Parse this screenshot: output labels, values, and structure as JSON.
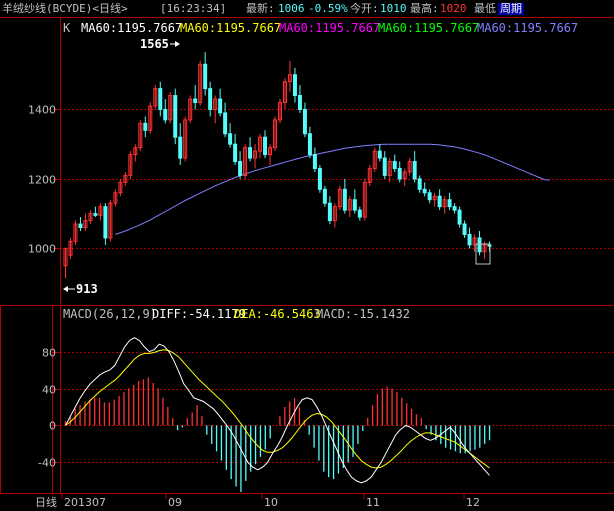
{
  "header": {
    "instrument": "羊绒纱线(BCYDE)<日线>",
    "time": "[16:23:34]",
    "latest_label": "最新:",
    "latest_value": "1006",
    "change_pct": "-0.59%",
    "open_label": "今开:",
    "open_value": "1010",
    "high_label": "最高:",
    "high_value": "1020",
    "last_label": "最低",
    "period_label": "周期"
  },
  "price_panel": {
    "k_label": "K",
    "ma_labels": [
      "MA60:1195.7667",
      "MA60:1195.7667",
      "MA60:1195.7667",
      "MA60:1195.7667",
      "MA60:1195.7667"
    ],
    "ma_colors": [
      "#ffffff",
      "#ffff00",
      "#ff00ff",
      "#00ff00",
      "#8080ff"
    ],
    "y_ticks": [
      "1400",
      "1200",
      "1000"
    ],
    "annotations": {
      "high": "1565",
      "low": "913"
    }
  },
  "macd_panel": {
    "title": "MACD(26,12,9)",
    "diff": "DIFF:-54.1179",
    "dea": "DEA:-46.5463",
    "macd": "MACD:-15.1432",
    "y_ticks": [
      "80",
      "40",
      "0",
      "-40"
    ]
  },
  "x_axis": {
    "period": "日线",
    "labels": [
      "201307",
      "09",
      "10",
      "11",
      "12"
    ]
  },
  "colors": {
    "up": "#ff3232",
    "down": "#54fcfc",
    "grid": "#b00000",
    "ma_line": "#8080ff",
    "diff": "#ffffff",
    "dea": "#ffff00",
    "bg": "#000000"
  },
  "chart_data": {
    "type": "candlestick",
    "price_ylim": [
      880,
      1600
    ],
    "macd_ylim": [
      -72,
      112
    ],
    "high": 1565,
    "low": 913,
    "ma60": [
      null,
      null,
      null,
      null,
      null,
      null,
      null,
      null,
      null,
      null,
      1040,
      1045,
      1050,
      1056,
      1062,
      1068,
      1075,
      1082,
      1090,
      1098,
      1106,
      1114,
      1122,
      1130,
      1138,
      1145,
      1152,
      1159,
      1166,
      1173,
      1180,
      1186,
      1192,
      1198,
      1204,
      1209,
      1214,
      1219,
      1224,
      1228,
      1232,
      1236,
      1240,
      1244,
      1248,
      1252,
      1256,
      1260,
      1264,
      1267,
      1270,
      1273,
      1276,
      1279,
      1282,
      1285,
      1288,
      1290,
      1292,
      1294,
      1296,
      1297,
      1298,
      1299,
      1300,
      1300,
      1300,
      1300,
      1300,
      1300,
      1300,
      1300,
      1300,
      1300,
      1299,
      1298,
      1296,
      1294,
      1292,
      1289,
      1286,
      1282,
      1278,
      1274,
      1269,
      1264,
      1258,
      1252,
      1246,
      1240,
      1234,
      1228,
      1222,
      1216,
      1210,
      1204,
      1198,
      1196
    ],
    "candles": [
      [
        950,
        1000,
        913,
        1000
      ],
      [
        980,
        1030,
        970,
        1020
      ],
      [
        1020,
        1080,
        1010,
        1070
      ],
      [
        1070,
        1090,
        1050,
        1060
      ],
      [
        1060,
        1100,
        1050,
        1080
      ],
      [
        1080,
        1110,
        1070,
        1100
      ],
      [
        1100,
        1120,
        1090,
        1095
      ],
      [
        1095,
        1130,
        1080,
        1120
      ],
      [
        1120,
        1130,
        1010,
        1030
      ],
      [
        1030,
        1140,
        1020,
        1130
      ],
      [
        1130,
        1170,
        1120,
        1160
      ],
      [
        1160,
        1200,
        1150,
        1190
      ],
      [
        1190,
        1220,
        1180,
        1210
      ],
      [
        1210,
        1280,
        1200,
        1270
      ],
      [
        1270,
        1300,
        1250,
        1290
      ],
      [
        1290,
        1370,
        1280,
        1360
      ],
      [
        1360,
        1380,
        1320,
        1340
      ],
      [
        1340,
        1420,
        1330,
        1410
      ],
      [
        1410,
        1470,
        1400,
        1460
      ],
      [
        1460,
        1480,
        1380,
        1400
      ],
      [
        1400,
        1430,
        1360,
        1370
      ],
      [
        1370,
        1450,
        1360,
        1440
      ],
      [
        1440,
        1460,
        1300,
        1320
      ],
      [
        1320,
        1360,
        1240,
        1260
      ],
      [
        1260,
        1380,
        1250,
        1370
      ],
      [
        1370,
        1440,
        1360,
        1430
      ],
      [
        1430,
        1470,
        1400,
        1420
      ],
      [
        1420,
        1540,
        1410,
        1530
      ],
      [
        1530,
        1565,
        1440,
        1460
      ],
      [
        1460,
        1480,
        1380,
        1400
      ],
      [
        1400,
        1440,
        1360,
        1430
      ],
      [
        1430,
        1460,
        1380,
        1390
      ],
      [
        1390,
        1420,
        1320,
        1330
      ],
      [
        1330,
        1360,
        1290,
        1300
      ],
      [
        1300,
        1330,
        1240,
        1250
      ],
      [
        1250,
        1280,
        1200,
        1210
      ],
      [
        1210,
        1300,
        1200,
        1290
      ],
      [
        1290,
        1320,
        1250,
        1260
      ],
      [
        1260,
        1300,
        1230,
        1280
      ],
      [
        1280,
        1330,
        1260,
        1320
      ],
      [
        1320,
        1340,
        1260,
        1270
      ],
      [
        1270,
        1300,
        1240,
        1290
      ],
      [
        1290,
        1380,
        1280,
        1370
      ],
      [
        1370,
        1430,
        1360,
        1420
      ],
      [
        1420,
        1490,
        1400,
        1480
      ],
      [
        1480,
        1540,
        1450,
        1500
      ],
      [
        1500,
        1520,
        1420,
        1440
      ],
      [
        1440,
        1470,
        1390,
        1400
      ],
      [
        1400,
        1420,
        1320,
        1330
      ],
      [
        1330,
        1350,
        1260,
        1270
      ],
      [
        1270,
        1290,
        1220,
        1230
      ],
      [
        1230,
        1240,
        1160,
        1170
      ],
      [
        1170,
        1180,
        1120,
        1130
      ],
      [
        1130,
        1150,
        1070,
        1080
      ],
      [
        1080,
        1130,
        1060,
        1120
      ],
      [
        1120,
        1180,
        1110,
        1170
      ],
      [
        1170,
        1200,
        1100,
        1110
      ],
      [
        1110,
        1150,
        1090,
        1140
      ],
      [
        1140,
        1170,
        1100,
        1110
      ],
      [
        1110,
        1120,
        1080,
        1090
      ],
      [
        1090,
        1200,
        1080,
        1190
      ],
      [
        1190,
        1240,
        1180,
        1230
      ],
      [
        1230,
        1290,
        1220,
        1280
      ],
      [
        1280,
        1300,
        1250,
        1260
      ],
      [
        1260,
        1280,
        1200,
        1210
      ],
      [
        1210,
        1260,
        1190,
        1250
      ],
      [
        1250,
        1270,
        1220,
        1230
      ],
      [
        1230,
        1250,
        1190,
        1200
      ],
      [
        1200,
        1230,
        1180,
        1220
      ],
      [
        1220,
        1260,
        1210,
        1250
      ],
      [
        1250,
        1280,
        1190,
        1200
      ],
      [
        1200,
        1210,
        1160,
        1170
      ],
      [
        1170,
        1190,
        1150,
        1160
      ],
      [
        1160,
        1170,
        1130,
        1140
      ],
      [
        1140,
        1160,
        1120,
        1150
      ],
      [
        1150,
        1170,
        1110,
        1120
      ],
      [
        1120,
        1150,
        1100,
        1140
      ],
      [
        1140,
        1160,
        1110,
        1120
      ],
      [
        1120,
        1130,
        1100,
        1110
      ],
      [
        1110,
        1120,
        1060,
        1070
      ],
      [
        1070,
        1080,
        1030,
        1040
      ],
      [
        1040,
        1060,
        1000,
        1010
      ],
      [
        1010,
        1040,
        990,
        1030
      ],
      [
        1030,
        1050,
        980,
        990
      ],
      [
        990,
        1020,
        970,
        1010
      ],
      [
        1010,
        1020,
        990,
        1006
      ]
    ],
    "macd_hist": [
      5,
      10,
      18,
      22,
      26,
      28,
      30,
      30,
      25,
      25,
      28,
      32,
      36,
      40,
      44,
      48,
      50,
      52,
      46,
      40,
      30,
      20,
      8,
      -5,
      -2,
      8,
      14,
      22,
      10,
      -10,
      -20,
      -28,
      -38,
      -48,
      -58,
      -66,
      -72,
      -60,
      -50,
      -42,
      -34,
      -26,
      -14,
      0,
      10,
      20,
      26,
      30,
      20,
      6,
      -10,
      -24,
      -38,
      -50,
      -56,
      -58,
      -52,
      -46,
      -40,
      -34,
      -20,
      -6,
      8,
      22,
      34,
      40,
      42,
      40,
      36,
      30,
      24,
      18,
      12,
      8,
      -4,
      -10,
      -16,
      -20,
      -24,
      -26,
      -28,
      -30,
      -30,
      -28,
      -26,
      -24,
      -20,
      -16
    ],
    "diff": [
      0,
      10,
      20,
      30,
      38,
      45,
      50,
      55,
      58,
      60,
      65,
      75,
      85,
      92,
      95,
      92,
      85,
      80,
      82,
      88,
      86,
      80,
      70,
      58,
      45,
      38,
      30,
      28,
      26,
      22,
      18,
      12,
      5,
      -2,
      -10,
      -20,
      -30,
      -40,
      -45,
      -48,
      -45,
      -40,
      -30,
      -22,
      -12,
      0,
      10,
      20,
      28,
      30,
      28,
      20,
      10,
      -2,
      -14,
      -26,
      -38,
      -48,
      -56,
      -60,
      -62,
      -60,
      -56,
      -48,
      -40,
      -30,
      -20,
      -10,
      -4,
      0,
      -2,
      -6,
      -10,
      -14,
      -16,
      -14,
      -10,
      -6,
      -2,
      -8,
      -16,
      -24,
      -30,
      -36,
      -42,
      -48,
      -54
    ],
    "dea": [
      0,
      4,
      9,
      15,
      21,
      27,
      32,
      37,
      41,
      45,
      49,
      54,
      60,
      66,
      72,
      76,
      78,
      78,
      79,
      81,
      82,
      81,
      78,
      74,
      68,
      62,
      56,
      50,
      45,
      40,
      35,
      30,
      25,
      19,
      13,
      6,
      -1,
      -9,
      -16,
      -22,
      -27,
      -29,
      -29,
      -27,
      -24,
      -19,
      -13,
      -6,
      1,
      7,
      11,
      13,
      12,
      9,
      4,
      -3,
      -10,
      -17,
      -25,
      -32,
      -38,
      -42,
      -45,
      -46,
      -45,
      -42,
      -38,
      -33,
      -28,
      -22,
      -17,
      -13,
      -10,
      -8,
      -8,
      -10,
      -12,
      -14,
      -16,
      -18,
      -22,
      -26,
      -30,
      -34,
      -38,
      -42,
      -46
    ]
  }
}
